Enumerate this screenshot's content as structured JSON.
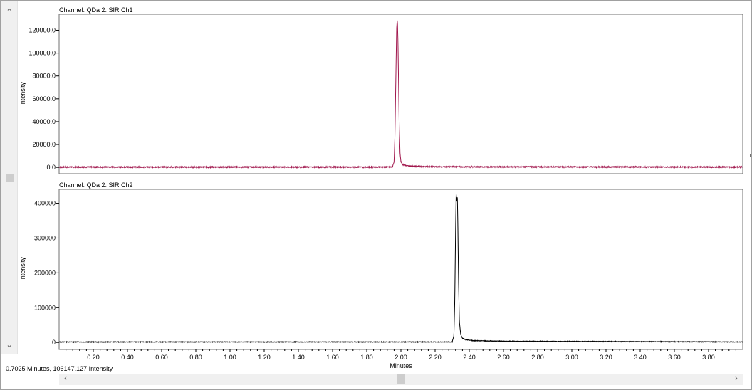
{
  "status": "0.7025 Minutes, 106147.127 Intensity",
  "chart_data": [
    {
      "type": "line",
      "title": "Channel: QDa 2: SIR Ch1",
      "xlabel": "",
      "ylabel": "Intensity",
      "xlim": [
        0.0,
        4.0
      ],
      "ylim": [
        -5500,
        134000
      ],
      "yticks": [
        0,
        20000,
        40000,
        60000,
        80000,
        100000,
        120000
      ],
      "ytick_labels": [
        "0.0",
        "20000.0",
        "40000.0",
        "60000.0",
        "80000.0",
        "100000.0",
        "120000.0"
      ],
      "color": "#a0164c",
      "baseline": 300,
      "series": [
        {
          "x": [
            0.0,
            1.95,
            1.96,
            1.965,
            1.97,
            1.975,
            1.978,
            1.98,
            1.983,
            1.986,
            1.99,
            1.995,
            2.0,
            2.01,
            2.03,
            2.06,
            2.1,
            2.2,
            4.0
          ],
          "values": [
            300,
            300,
            5000,
            28000,
            75000,
            122000,
            129000,
            126000,
            108000,
            75000,
            36000,
            12000,
            5000,
            2500,
            1600,
            1100,
            800,
            500,
            300
          ]
        }
      ]
    },
    {
      "type": "line",
      "title": "Channel: QDa 2: SIR Ch2",
      "xlabel": "Minutes",
      "ylabel": "Intensity",
      "xlim": [
        0.0,
        4.0
      ],
      "ylim": [
        -20000,
        440000
      ],
      "yticks": [
        0,
        100000,
        200000,
        300000,
        400000
      ],
      "ytick_labels": [
        "0",
        "100000",
        "200000",
        "300000",
        "400000"
      ],
      "xticks": [
        0.2,
        0.4,
        0.6,
        0.8,
        1.0,
        1.2,
        1.4,
        1.6,
        1.8,
        2.0,
        2.2,
        2.4,
        2.6,
        2.8,
        3.0,
        3.2,
        3.4,
        3.6,
        3.8
      ],
      "xtick_labels": [
        "0.20",
        "0.40",
        "0.60",
        "0.80",
        "1.00",
        "1.20",
        "1.40",
        "1.60",
        "1.80",
        "2.00",
        "2.20",
        "2.40",
        "2.60",
        "2.80",
        "3.00",
        "3.20",
        "3.40",
        "3.60",
        "3.80"
      ],
      "color": "#000000",
      "baseline": 1500,
      "series": [
        {
          "x": [
            0.0,
            2.3,
            2.31,
            2.315,
            2.32,
            2.323,
            2.326,
            2.33,
            2.333,
            2.337,
            2.342,
            2.35,
            2.36,
            2.38,
            2.42,
            2.5,
            2.6,
            4.0
          ],
          "values": [
            1500,
            1500,
            20000,
            120000,
            330000,
            430000,
            405000,
            420000,
            340000,
            180000,
            60000,
            22000,
            12000,
            8000,
            5500,
            4500,
            3500,
            1500
          ]
        }
      ]
    }
  ]
}
